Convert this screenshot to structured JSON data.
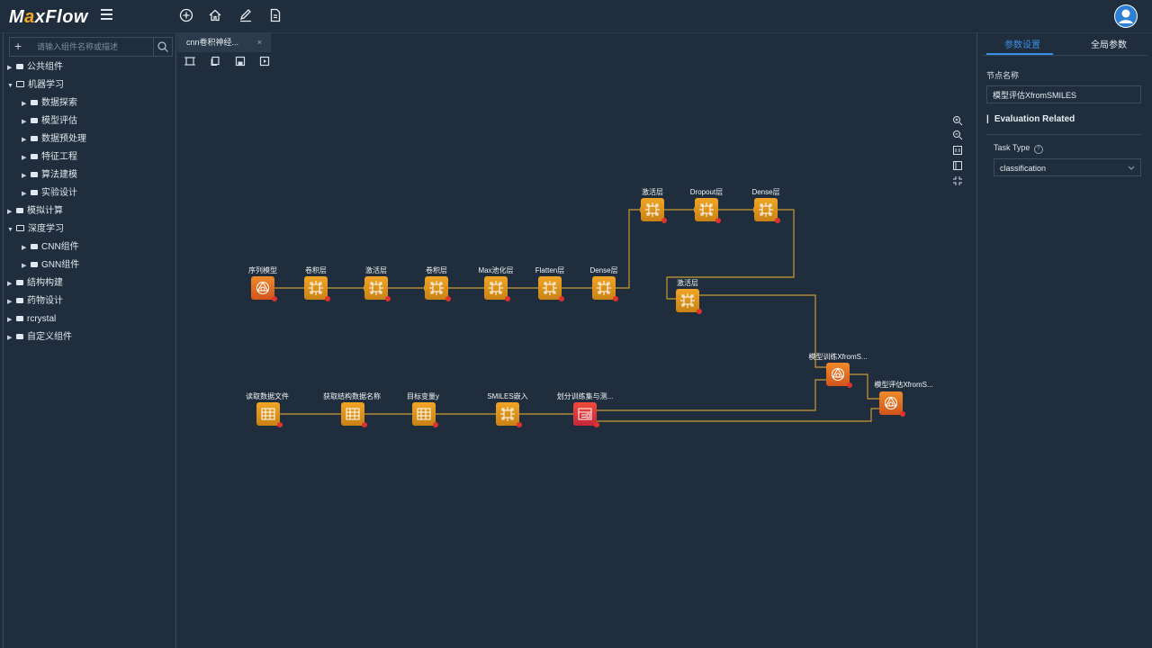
{
  "app": {
    "logo_main": "MaxFlow",
    "logo_x": "x"
  },
  "topbar": {
    "icons": [
      "add-circle-icon",
      "home-icon",
      "edit-icon",
      "document-icon"
    ],
    "user": "user-avatar-icon"
  },
  "search": {
    "placeholder": "请输入组件名称或描述"
  },
  "tree": [
    {
      "label": "公共组件",
      "level": 0,
      "open": false
    },
    {
      "label": "机器学习",
      "level": 0,
      "open": true
    },
    {
      "label": "数据探索",
      "level": 1,
      "open": false
    },
    {
      "label": "模型评估",
      "level": 1,
      "open": false
    },
    {
      "label": "数据预处理",
      "level": 1,
      "open": false
    },
    {
      "label": "特征工程",
      "level": 1,
      "open": false
    },
    {
      "label": "算法建模",
      "level": 1,
      "open": false
    },
    {
      "label": "实验设计",
      "level": 1,
      "open": false
    },
    {
      "label": "模拟计算",
      "level": 0,
      "open": false
    },
    {
      "label": "深度学习",
      "level": 0,
      "open": true
    },
    {
      "label": "CNN组件",
      "level": 1,
      "open": false
    },
    {
      "label": "GNN组件",
      "level": 1,
      "open": false
    },
    {
      "label": "结构构建",
      "level": 0,
      "open": false
    },
    {
      "label": "药物设计",
      "level": 0,
      "open": false
    },
    {
      "label": "rcrystal",
      "level": 0,
      "open": false
    },
    {
      "label": "自定义组件",
      "level": 0,
      "open": false
    }
  ],
  "editor": {
    "tab_label": "cnn卷积神经...",
    "tab_close": "×"
  },
  "flow": {
    "row1": [
      "序列模型",
      "卷积层",
      "激活层",
      "卷积层",
      "Max池化层",
      "Flatten层",
      "Dense层"
    ],
    "row0": [
      "激活层",
      "Dropout层",
      "Dense层"
    ],
    "mid": "激活层",
    "train": "模型训练XfromS...",
    "eval": "模型评估XfromS...",
    "row2": [
      "读取数据文件",
      "获取结构数据名称",
      "目标变量y",
      "SMILES嵌入",
      "划分训练集与测..."
    ]
  },
  "panel": {
    "tab_params": "参数设置",
    "tab_global": "全局参数",
    "node_name_label": "节点名称",
    "node_name_value": "模型评估XfromSMILES",
    "section": "Evaluation Related",
    "task_type_label": "Task Type",
    "task_type_value": "classification"
  },
  "colors": {
    "accent": "#3a8ee6",
    "node_orange": "#f0a526",
    "node_red": "#e04848",
    "edge": "#c99a33"
  }
}
